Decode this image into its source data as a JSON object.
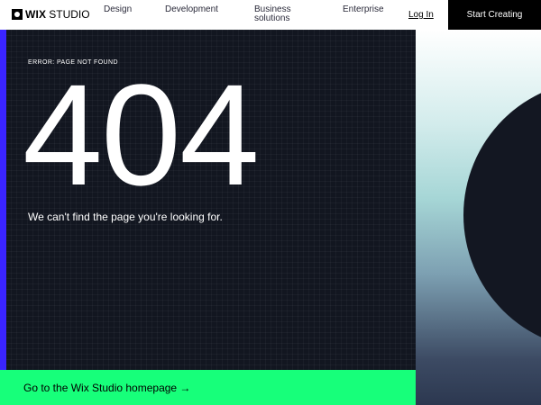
{
  "header": {
    "logo_bold": "WIX",
    "logo_text": "STUDIO",
    "nav": {
      "design": "Design",
      "development": "Development",
      "business": "Business solutions",
      "enterprise": "Enterprise"
    },
    "login": "Log In",
    "start": "Start Creating"
  },
  "main": {
    "error_label": "ERROR: PAGE NOT FOUND",
    "code": "404",
    "message": "We can't find the page you're looking for.",
    "cta": "Go to the Wix Studio homepage →"
  },
  "colors": {
    "dark_bg": "#121620",
    "accent_strip": "#3a24ff",
    "cta_green": "#17ff7a",
    "header_bg": "#ffffff"
  }
}
